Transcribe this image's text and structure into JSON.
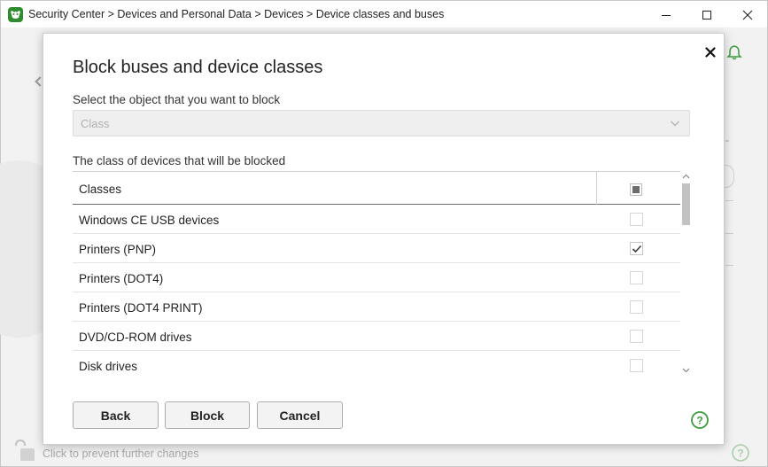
{
  "window": {
    "breadcrumb": "Security Center > Devices and Personal Data > Devices > Device classes and buses",
    "icons": {
      "logo": "app-logo-icon",
      "minimize": "minimize-icon",
      "maximize": "maximize-icon",
      "close": "close-icon"
    }
  },
  "background": {
    "lock_text": "Click to prevent further changes",
    "icons": {
      "back": "back-arrow-icon",
      "bell": "bell-icon",
      "lock": "unlock-icon",
      "help": "help-icon"
    }
  },
  "dialog": {
    "title": "Block buses and device classes",
    "select_label": "Select the object that you want to block",
    "select_value": "Class",
    "table_label": "The class of devices that will be blocked",
    "table": {
      "header": "Classes",
      "header_checkbox_state": "indeterminate",
      "rows": [
        {
          "label": "Windows CE USB devices",
          "checked": false
        },
        {
          "label": "Printers (PNP)",
          "checked": true
        },
        {
          "label": "Printers (DOT4)",
          "checked": false
        },
        {
          "label": "Printers (DOT4 PRINT)",
          "checked": false
        },
        {
          "label": "DVD/CD-ROM drives",
          "checked": false
        },
        {
          "label": "Disk drives",
          "checked": false
        }
      ]
    },
    "buttons": {
      "back": "Back",
      "block": "Block",
      "cancel": "Cancel"
    },
    "colors": {
      "accent_green": "#3c9d3c"
    }
  }
}
